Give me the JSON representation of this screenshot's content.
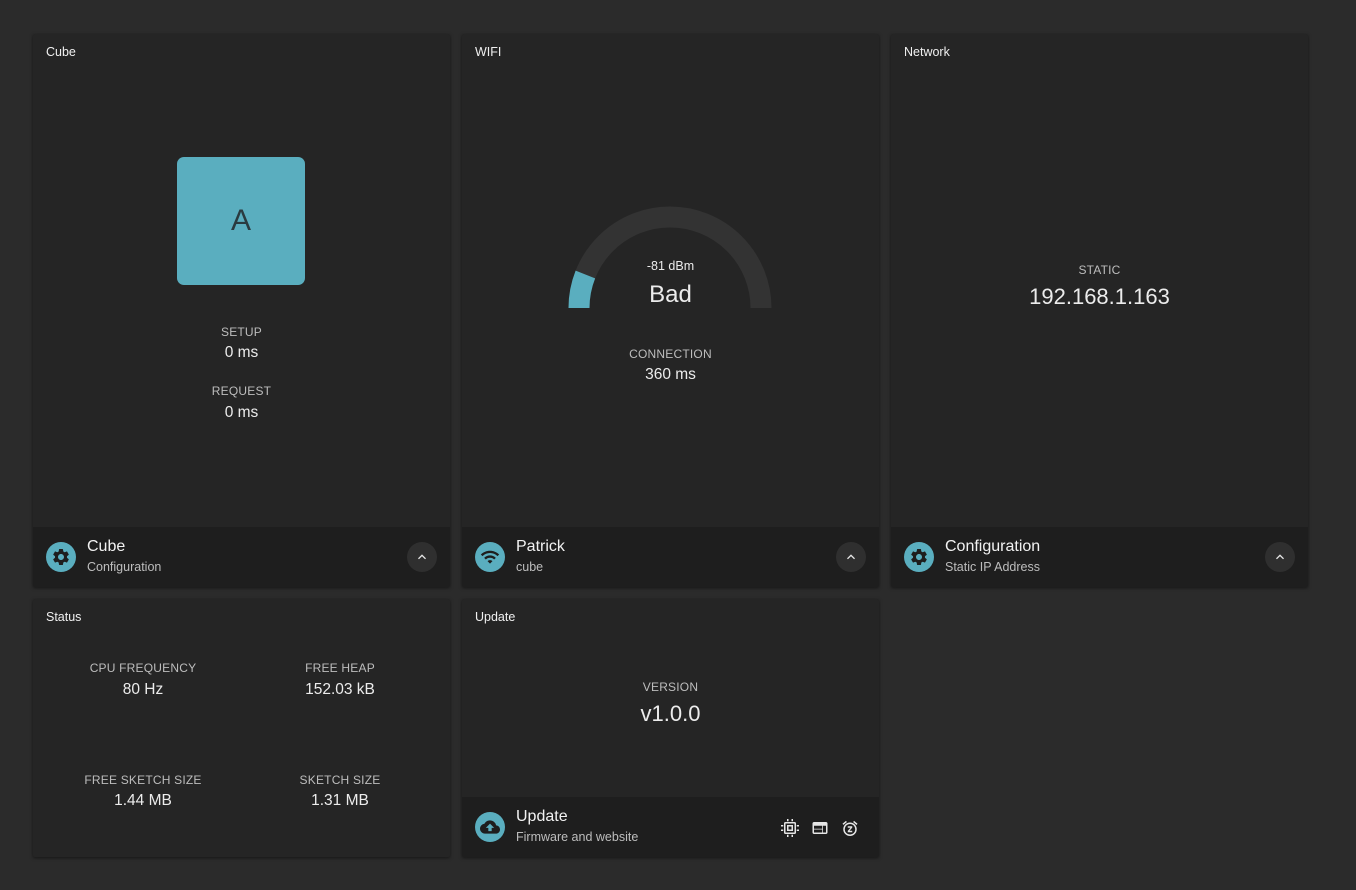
{
  "cube_card": {
    "title": "Cube",
    "letter": "A",
    "cube_color": "#5aaebf",
    "setup_label": "SETUP",
    "setup_value": "0 ms",
    "request_label": "REQUEST",
    "request_value": "0 ms",
    "footer_title": "Cube",
    "footer_sub": "Configuration",
    "footer_icon": "gear-icon"
  },
  "wifi_card": {
    "title": "WIFI",
    "signal_text": "-81 dBm",
    "quality": "Bad",
    "gauge_fraction": 0.12,
    "connection_label": "CONNECTION",
    "connection_value": "360 ms",
    "footer_title": "Patrick",
    "footer_sub": "cube",
    "footer_icon": "wifi-icon"
  },
  "network_card": {
    "title": "Network",
    "mode_label": "STATIC",
    "ip": "192.168.1.163",
    "footer_title": "Configuration",
    "footer_sub": "Static IP Address",
    "footer_icon": "gear-icon"
  },
  "status_card": {
    "title": "Status",
    "cpu_label": "CPU FREQUENCY",
    "cpu_value": "80 Hz",
    "heap_label": "FREE HEAP",
    "heap_value": "152.03 kB",
    "free_sketch_label": "FREE SKETCH SIZE",
    "free_sketch_value": "1.44 MB",
    "sketch_label": "SKETCH SIZE",
    "sketch_value": "1.31 MB"
  },
  "update_card": {
    "title": "Update",
    "version_label": "VERSION",
    "version_value": "v1.0.0",
    "footer_title": "Update",
    "footer_sub": "Firmware and website",
    "footer_icon": "cloud-upload-icon",
    "action_icons": [
      "chip-icon",
      "web-icon",
      "sleep-alarm-icon"
    ]
  },
  "colors": {
    "accent": "#5aaebf",
    "background": "#2b2b2b",
    "card": "#252525",
    "footer": "#1e1e1e"
  }
}
